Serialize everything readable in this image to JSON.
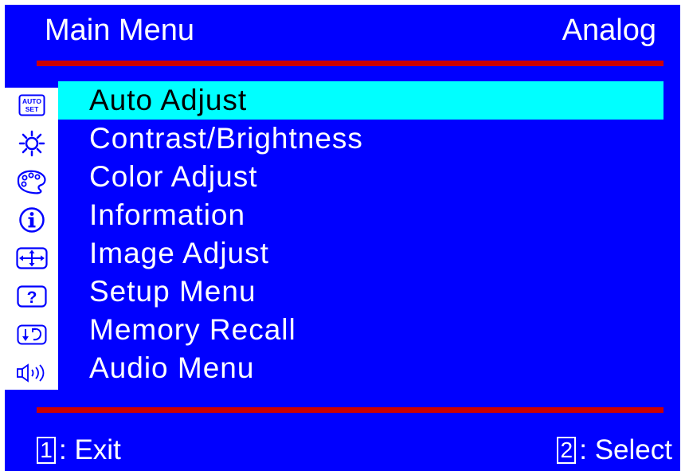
{
  "header": {
    "title": "Main Menu",
    "input_mode": "Analog"
  },
  "menu": {
    "selected_index": 0,
    "items": [
      {
        "label": "Auto Adjust",
        "icon": "auto-set-icon",
        "icon_text": [
          "AUTO",
          "SET"
        ]
      },
      {
        "label": "Contrast/Brightness",
        "icon": "sun-icon"
      },
      {
        "label": "Color Adjust",
        "icon": "palette-icon"
      },
      {
        "label": "Information",
        "icon": "info-icon"
      },
      {
        "label": "Image Adjust",
        "icon": "resize-arrows-icon"
      },
      {
        "label": "Setup Menu",
        "icon": "question-icon"
      },
      {
        "label": "Memory Recall",
        "icon": "recall-icon"
      },
      {
        "label": "Audio Menu",
        "icon": "speaker-icon"
      }
    ]
  },
  "footer": {
    "exit_key": "1",
    "exit_label": ": Exit",
    "select_key": "2",
    "select_label": ": Select"
  },
  "colors": {
    "background": "#0000FF",
    "highlight": "#00FFFF",
    "rule": "#CC0000",
    "text": "#FFFFFF"
  }
}
